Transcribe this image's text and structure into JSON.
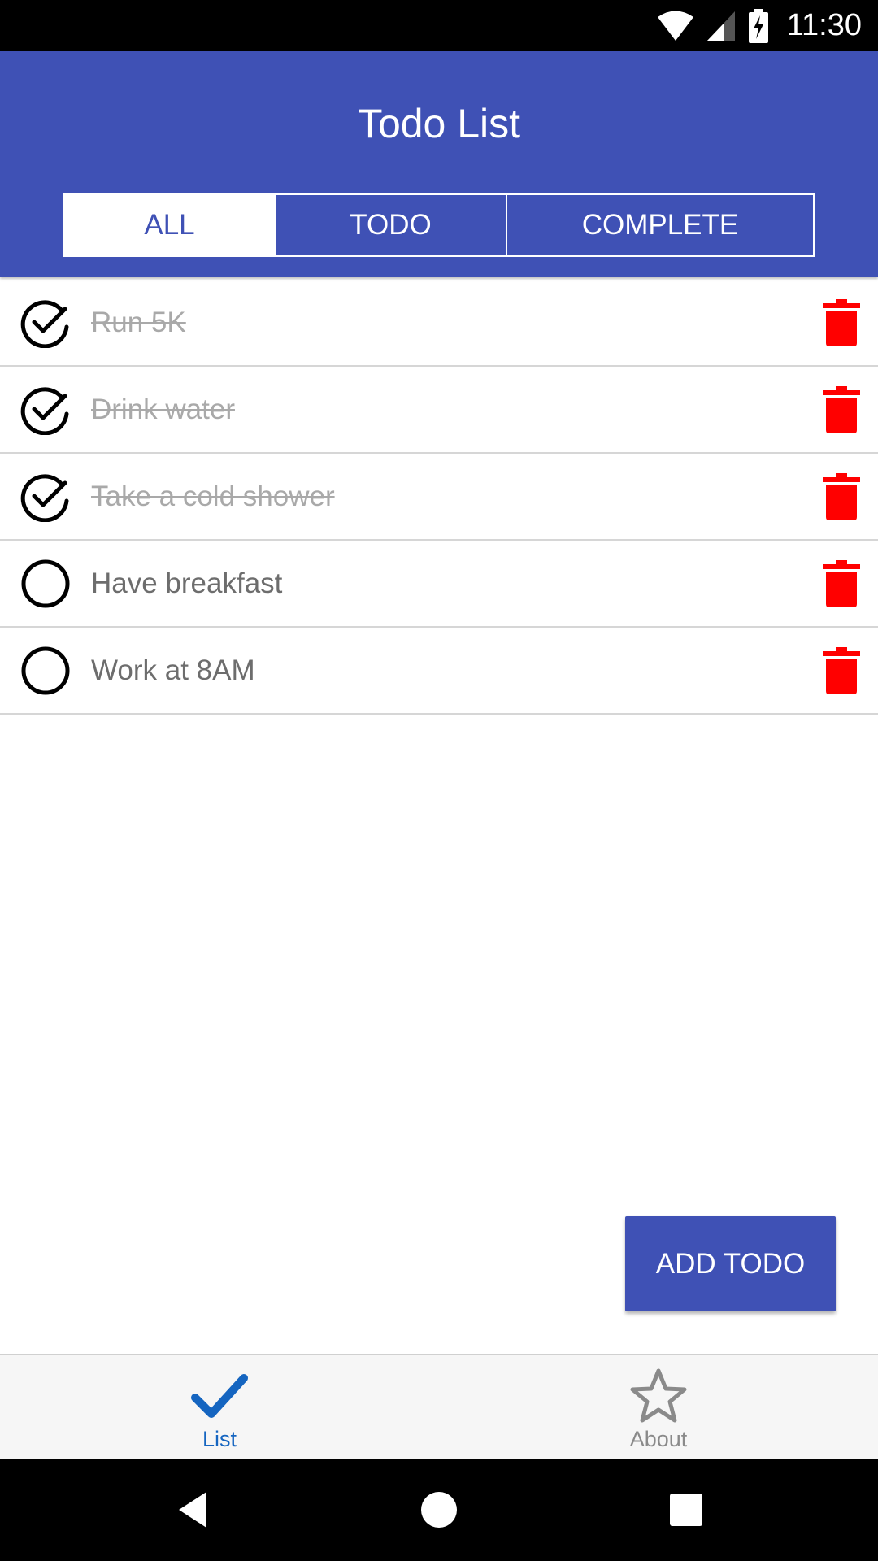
{
  "status_bar": {
    "time": "11:30",
    "icons": [
      "wifi-icon",
      "signal-icon",
      "battery-charging-icon"
    ]
  },
  "app_bar": {
    "title": "Todo List",
    "filters": [
      {
        "label": "ALL",
        "active": true
      },
      {
        "label": "TODO",
        "active": false
      },
      {
        "label": "COMPLETE",
        "active": false
      }
    ]
  },
  "todos": [
    {
      "text": "Run 5K",
      "completed": true
    },
    {
      "text": "Drink water",
      "completed": true
    },
    {
      "text": "Take a cold shower",
      "completed": true
    },
    {
      "text": "Have breakfast",
      "completed": false
    },
    {
      "text": "Work at 8AM",
      "completed": false
    }
  ],
  "add_button": {
    "label": "ADD TODO"
  },
  "tab_bar": {
    "tabs": [
      {
        "label": "List",
        "icon": "check-icon",
        "active": true
      },
      {
        "label": "About",
        "icon": "star-icon",
        "active": false
      }
    ]
  },
  "colors": {
    "primary": "#3f51b5",
    "trash": "#ff0000",
    "active_tab": "#1565c0",
    "inactive_tab": "#8a8a8a"
  }
}
